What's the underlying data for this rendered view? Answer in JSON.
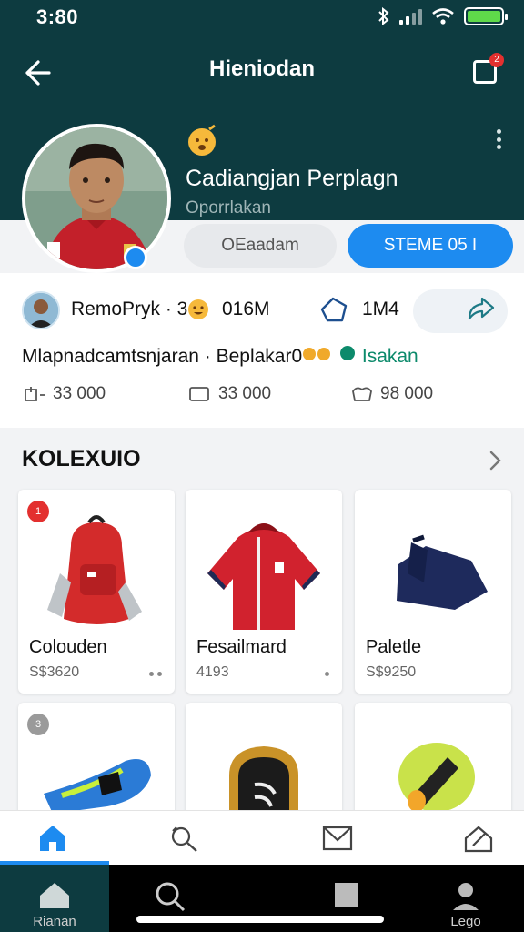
{
  "status_bar": {
    "time": "3:80"
  },
  "nav": {
    "title": "Hieniodan",
    "notification_count": "2"
  },
  "profile": {
    "name": "Cadiangjan Perplagn",
    "subtitle": "Oporrlakan",
    "secondary_button": "OEaadam",
    "primary_button": "STEME 05 I"
  },
  "post": {
    "user": "RemoPryk · 3",
    "views": "016M",
    "likes": "1M4",
    "text": "Mlapnadcamtsnjaran · Beplakar0",
    "tag": "Isakan",
    "stats": {
      "reposts": "33 000",
      "comments": "33 000",
      "saves": "98 000"
    }
  },
  "collection": {
    "title": "KOLEXUIO",
    "items": [
      {
        "name": "Colouden",
        "price": "S$3620",
        "badge": "1"
      },
      {
        "name": "Fesailmard",
        "price": "4193",
        "badge": ""
      },
      {
        "name": "Paletle",
        "price": "S$9250",
        "badge": ""
      },
      {
        "name": "",
        "price": "",
        "badge": "3"
      },
      {
        "name": "",
        "price": "",
        "badge": ""
      },
      {
        "name": "",
        "price": "",
        "badge": ""
      }
    ]
  },
  "tabbar": {
    "icons": [
      "home-icon",
      "search-icon",
      "mail-icon",
      "edit-icon"
    ]
  },
  "dock": {
    "home": "Rianan",
    "search": "",
    "apps": "",
    "profile": "Lego"
  },
  "colors": {
    "header": "#0d3b40",
    "accent": "#1d8bf0",
    "badge": "#e3302f"
  }
}
